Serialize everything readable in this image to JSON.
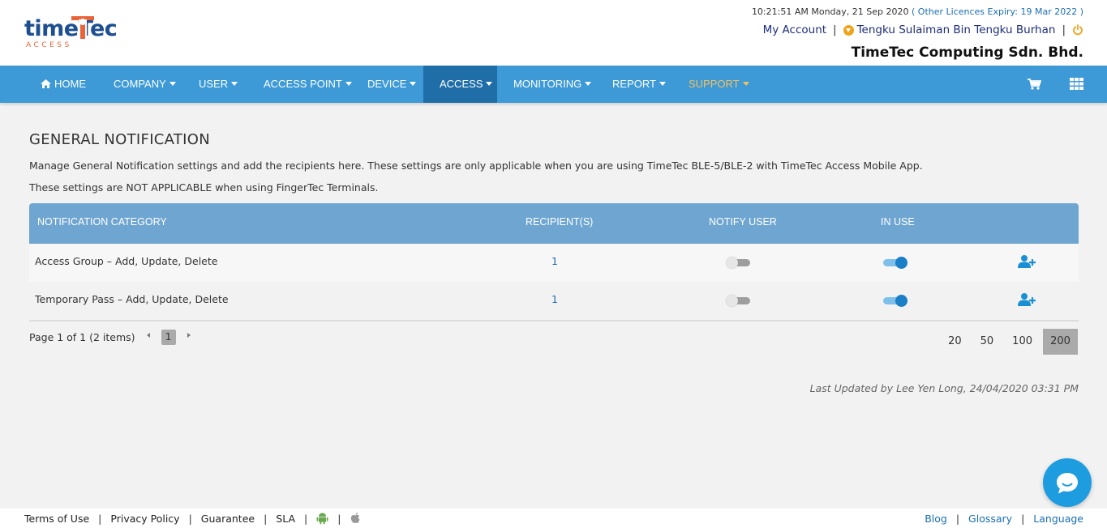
{
  "header": {
    "logo_text_a": "time",
    "logo_text_b": "Tec",
    "logo_sub": "ACCESS",
    "datetime": "10:21:51 AM Monday, 21 Sep 2020",
    "licence_prefix": "( Other Licences Expiry:",
    "licence_date": "19 Mar 2022 )",
    "my_account": "My Account",
    "sep": "|",
    "user_name": "Tengku Sulaiman Bin Tengku Burhan",
    "company_name": "TimeTec Computing Sdn. Bhd."
  },
  "nav": {
    "items": [
      {
        "label": "HOME"
      },
      {
        "label": "COMPANY"
      },
      {
        "label": "USER"
      },
      {
        "label": "ACCESS POINT"
      },
      {
        "label": "DEVICE"
      },
      {
        "label": "ACCESS"
      },
      {
        "label": "MONITORING"
      },
      {
        "label": "REPORT"
      },
      {
        "label": "SUPPORT"
      }
    ],
    "active": "ACCESS",
    "bg_color": "#3d9ad6",
    "active_color": "#1f6ea8",
    "support_color": "#f5c060",
    "right_icons": [
      "cart-icon",
      "grid-apps-icon"
    ]
  },
  "main": {
    "title": "GENERAL NOTIFICATION",
    "desc1": "Manage General Notification settings and add the recipients here. These settings are only applicable when you are using TimeTec BLE-5/BLE-2 with TimeTec Access Mobile App.",
    "desc2": "These settings are NOT APPLICABLE when using FingerTec Terminals.",
    "table": {
      "columns": [
        "NOTIFICATION CATEGORY",
        "RECIPIENT(S)",
        "NOTIFY USER",
        "IN USE"
      ],
      "rows": [
        {
          "category": "Access Group – Add, Update, Delete",
          "recipients": "1",
          "notify_user": false,
          "in_use": true
        },
        {
          "category": "Temporary Pass – Add, Update, Delete",
          "recipients": "1",
          "notify_user": false,
          "in_use": true
        }
      ]
    },
    "pager": {
      "info": "Page 1 of 1 (2 items)",
      "current_page": "1",
      "page_sizes": [
        "20",
        "50",
        "100",
        "200"
      ],
      "selected_size": "200"
    },
    "last_updated": "Last Updated by Lee Yen Long, 24/04/2020 03:31 PM"
  },
  "footer": {
    "left_links": [
      "Terms of Use",
      "Privacy Policy",
      "Guarantee",
      "SLA"
    ],
    "right_links": [
      "Blog",
      "Glossary",
      "Language"
    ],
    "sep": "|",
    "icons": [
      "android-icon",
      "apple-icon"
    ]
  }
}
